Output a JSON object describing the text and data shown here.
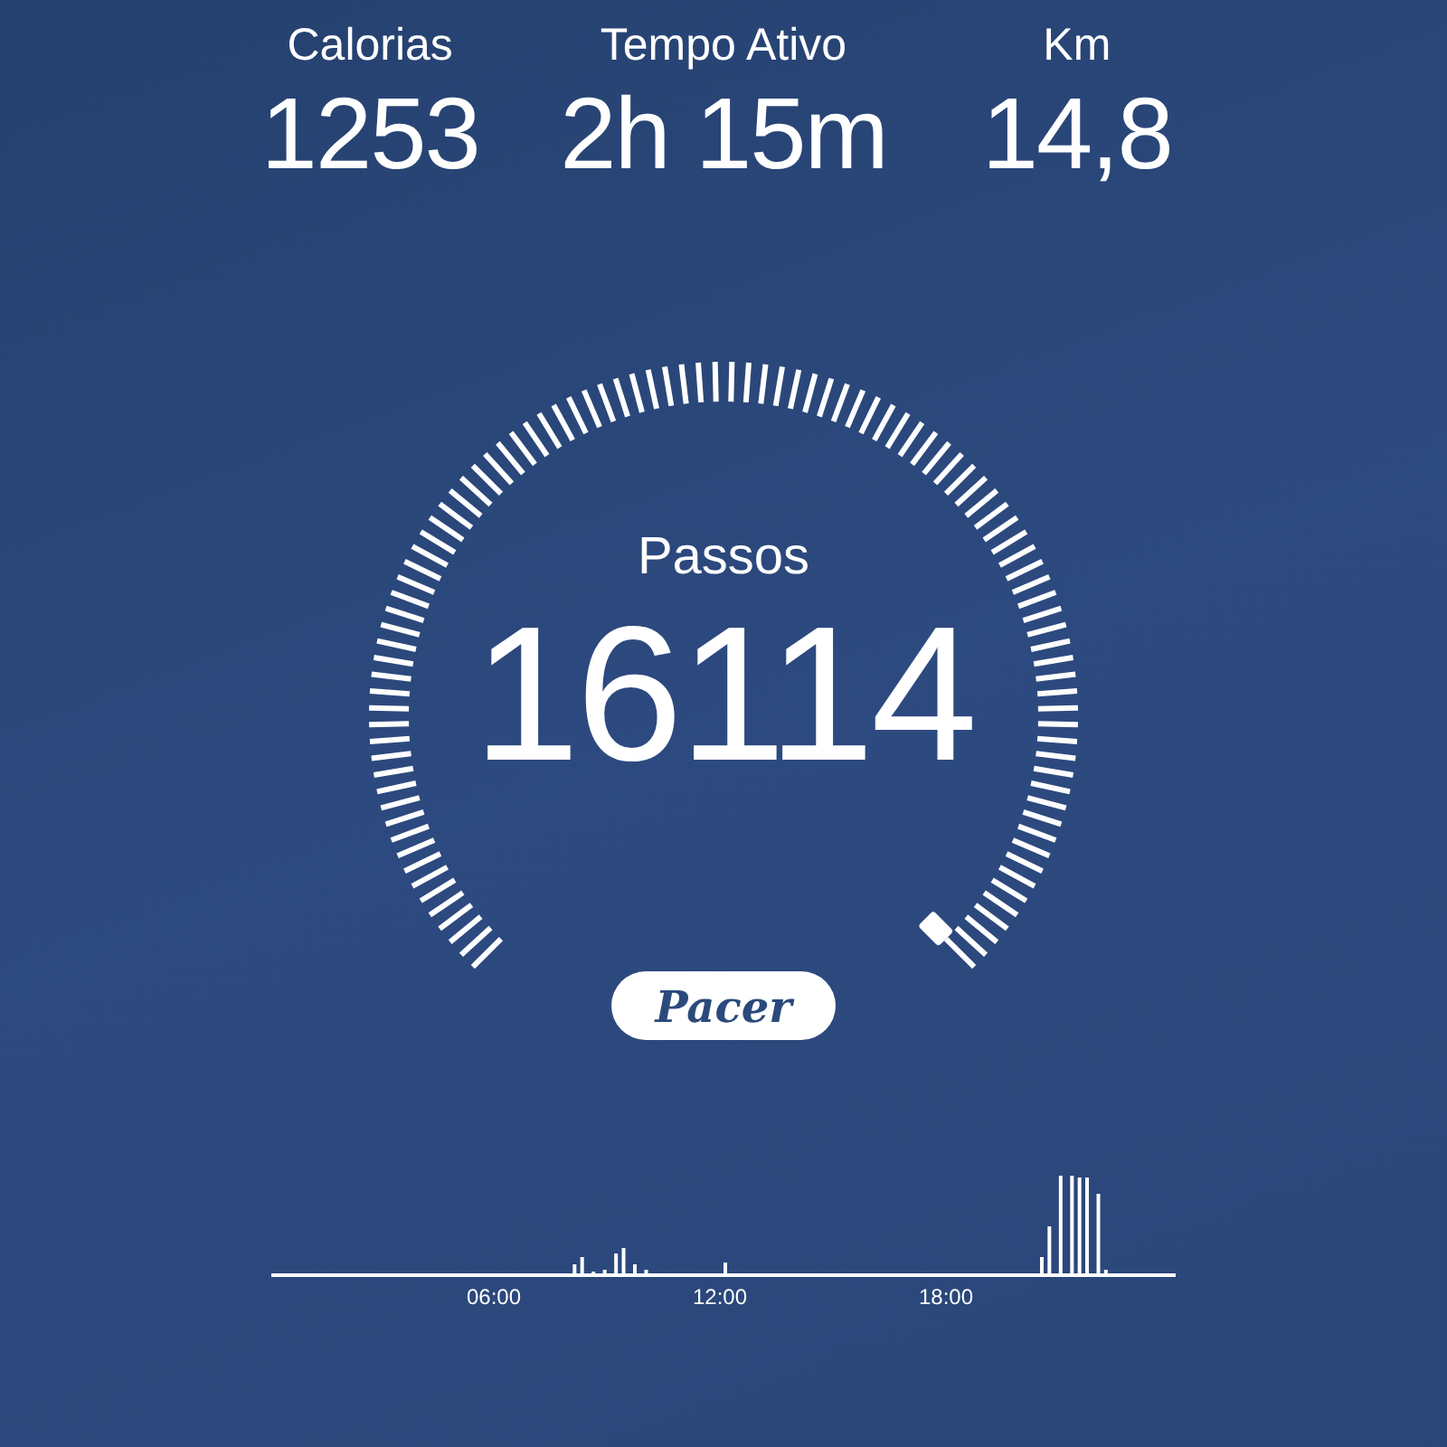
{
  "stats": [
    {
      "label": "Calorias",
      "value": "1253"
    },
    {
      "label": "Tempo Ativo",
      "value": "2h 15m"
    },
    {
      "label": "Km",
      "value": "14,8"
    }
  ],
  "steps": {
    "label": "Passos",
    "value": "16114"
  },
  "logo": "Pacer",
  "activity": {
    "time_labels": [
      "06:00",
      "12:00",
      "18:00"
    ]
  }
}
